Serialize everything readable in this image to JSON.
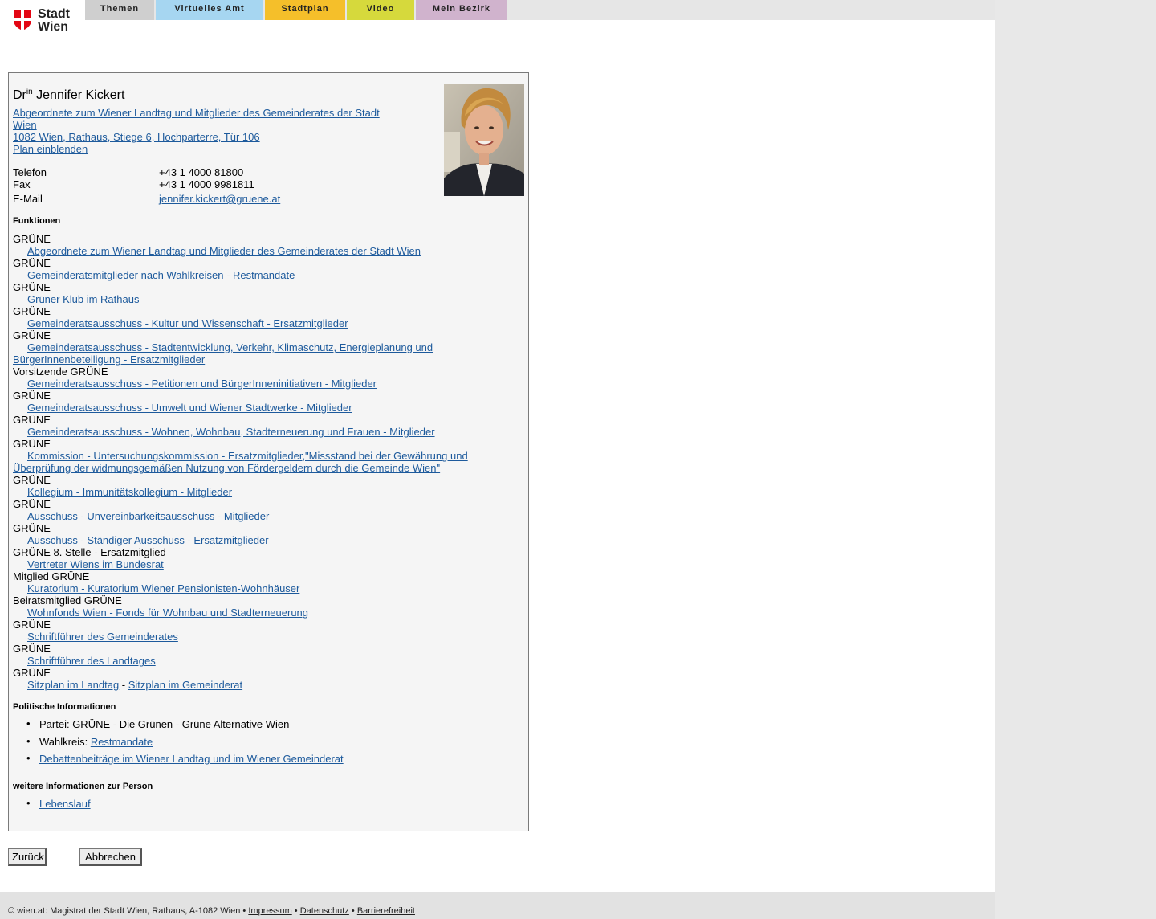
{
  "logo": {
    "line1": "Stadt",
    "line2": "Wien",
    "colors": {
      "red": "#e30613"
    }
  },
  "nav": [
    {
      "label": "Themen",
      "color": "#cfcfcf"
    },
    {
      "label": "Virtuelles Amt",
      "color": "#a6d6f1"
    },
    {
      "label": "Stadtplan",
      "color": "#f5bf2a"
    },
    {
      "label": "Video",
      "color": "#d6d93c"
    },
    {
      "label": "Mein Bezirk",
      "color": "#d0b3cd"
    }
  ],
  "person": {
    "title": "Dr",
    "title_sup": "in",
    "name": "Jennifer Kickert",
    "role_line1": "Abgeordnete zum Wiener Landtag und Mitglieder des Gemeinderates der Stadt",
    "role_line2": "Wien ",
    "address": "1082 Wien, Rathaus, Stiege 6, Hochparterre, Tür 106",
    "map_link": "Plan einblenden",
    "contact": {
      "phone_label": "Telefon",
      "phone": "+43 1 4000 81800",
      "phone2": "+43 1 4000 9981811",
      "fax_label": "Fax",
      "email_label": "E-Mail",
      "email": "jennifer.kickert@gruene.at"
    }
  },
  "functions": {
    "heading": "Funktionen",
    "items": [
      {
        "party": "GRÜNE",
        "link": "Abgeordnete zum Wiener Landtag und Mitglieder des Gemeinderates der Stadt Wien"
      },
      {
        "party": "GRÜNE",
        "link": "Gemeinderatsmitglieder nach Wahlkreisen - Restmandate"
      },
      {
        "party": "GRÜNE",
        "link": "Grüner Klub im Rathaus"
      },
      {
        "party": "GRÜNE",
        "link": "Gemeinderatsausschuss - Kultur und Wissenschaft - Ersatzmitglieder"
      },
      {
        "party": "GRÜNE",
        "link": "Gemeinderatsausschuss - Stadtentwicklung, Verkehr, Klimaschutz, Energieplanung und",
        "link2": "BürgerInnenbeteiligung - Ersatzmitglieder"
      },
      {
        "party": "Vorsitzende GRÜNE",
        "link": "Gemeinderatsausschuss - Petitionen und BürgerInneninitiativen - Mitglieder"
      },
      {
        "party": "GRÜNE",
        "link": "Gemeinderatsausschuss - Umwelt und Wiener Stadtwerke - Mitglieder"
      },
      {
        "party": "GRÜNE",
        "link": "Gemeinderatsausschuss - Wohnen, Wohnbau, Stadterneuerung und Frauen - Mitglieder"
      },
      {
        "party": "GRÜNE",
        "link": "Kommission - Untersuchungskommission - Ersatzmitglieder,\"Missstand bei der Gewährung und",
        "link2": "Überprüfung der widmungsgemäßen Nutzung von Fördergeldern durch die Gemeinde Wien\""
      },
      {
        "party": "GRÜNE",
        "link": "Kollegium - Immunitätskollegium - Mitglieder"
      },
      {
        "party": "GRÜNE",
        "link": "Ausschuss - Unvereinbarkeitsausschuss - Mitglieder"
      },
      {
        "party": "GRÜNE",
        "link": "Ausschuss - Ständiger Ausschuss - Ersatzmitglieder"
      },
      {
        "party": "GRÜNE 8. Stelle - Ersatzmitglied",
        "link": "Vertreter Wiens im Bundesrat"
      },
      {
        "party": "Mitglied GRÜNE",
        "link": "Kuratorium - Kuratorium Wiener Pensionisten-Wohnhäuser"
      },
      {
        "party": "Beiratsmitglied GRÜNE",
        "link": "Wohnfonds Wien - Fonds für Wohnbau und Stadterneuerung"
      },
      {
        "party": "GRÜNE",
        "link": "Schriftführer des Gemeinderates"
      },
      {
        "party": "GRÜNE",
        "link": "Schriftführer des Landtages"
      },
      {
        "party": "GRÜNE",
        "link": "Sitzplan im Landtag",
        "sep": " - ",
        "link_b": "Sitzplan im Gemeinderat"
      }
    ]
  },
  "political": {
    "heading": "Politische Informationen",
    "party_label": "Partei: ",
    "party_value": "GRÜNE - Die Grünen - Grüne Alternative Wien",
    "district_label": "Wahlkreis: ",
    "district_link": "Restmandate",
    "debates_link": "Debattenbeiträge im Wiener Landtag und im Wiener Gemeinderat"
  },
  "more": {
    "heading": "weitere Informationen zur Person",
    "cv_link": "Lebenslauf"
  },
  "buttons": {
    "back": "Zurück",
    "cancel": "Abbrechen"
  },
  "footer": {
    "text": "© wien.at: Magistrat der Stadt Wien, Rathaus, A-1082 Wien • ",
    "sep": " • ",
    "imprint": "Impressum",
    "privacy": "Datenschutz",
    "accessibility": "Barrierefreiheit"
  }
}
